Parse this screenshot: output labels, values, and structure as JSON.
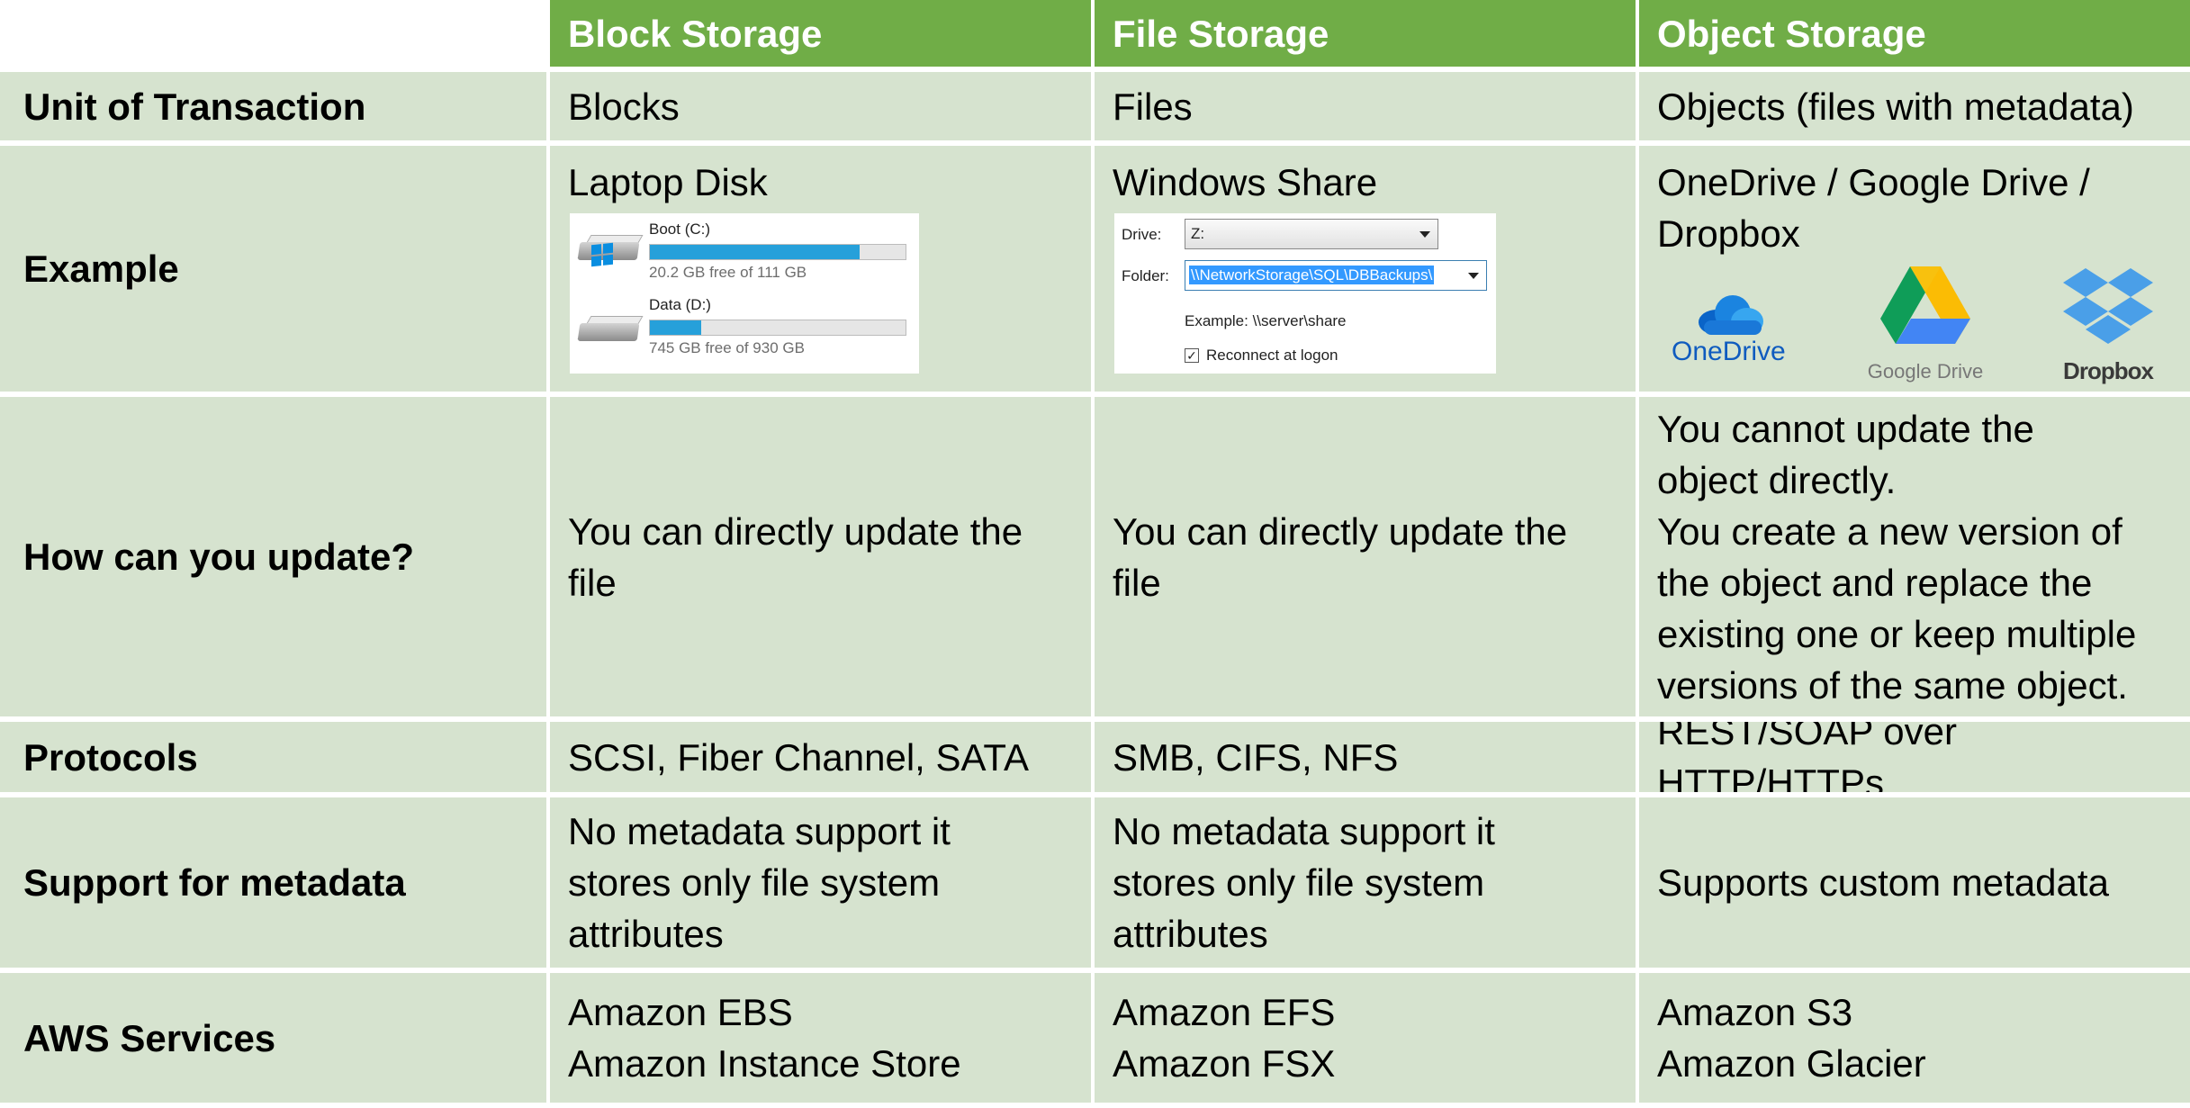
{
  "header": {
    "columns": [
      "Block Storage",
      "File Storage",
      "Object Storage"
    ]
  },
  "rows": {
    "unit": {
      "label": "Unit of Transaction",
      "values": [
        "Blocks",
        "Files",
        "Objects (files with metadata)"
      ]
    },
    "example": {
      "label": "Example",
      "values": [
        "Laptop Disk",
        "Windows Share",
        "OneDrive / Google Drive /\nDropbox"
      ]
    },
    "update": {
      "label": "How can you update?",
      "values": [
        "You can directly update the\nfile",
        "You can directly update the\nfile",
        "You cannot update the\nobject directly.\nYou create a new version of\nthe object and replace the\nexisting one or keep multiple\nversions of the same object."
      ]
    },
    "protocols": {
      "label": "Protocols",
      "values": [
        "SCSI, Fiber Channel, SATA",
        "SMB, CIFS, NFS",
        "REST/SOAP over HTTP/HTTPs"
      ]
    },
    "metadata": {
      "label": "Support for metadata",
      "values": [
        "No metadata support it\nstores only file system\nattributes",
        "No metadata support it\nstores only file system\nattributes",
        "Supports custom metadata"
      ]
    },
    "aws": {
      "label": "AWS Services",
      "values": [
        "Amazon EBS\nAmazon Instance Store",
        "Amazon EFS\nAmazon FSX",
        "Amazon S3\nAmazon Glacier"
      ]
    }
  },
  "laptop_disk": {
    "drives": [
      {
        "name": "Boot (C:)",
        "free": "20.2 GB free of 111 GB",
        "used_fraction": 0.82
      },
      {
        "name": "Data (D:)",
        "free": "745 GB free of 930 GB",
        "used_fraction": 0.2
      }
    ]
  },
  "windows_share": {
    "drive_label": "Drive:",
    "drive_value": "Z:",
    "folder_label": "Folder:",
    "folder_value": "\\\\NetworkStorage\\SQL\\DBBackups\\",
    "example_text": "Example: \\\\server\\share",
    "reconnect_label": "Reconnect at logon",
    "reconnect_checked": true
  },
  "logos": {
    "onedrive": "OneDrive",
    "googledrive": "Google Drive",
    "dropbox": "Dropbox"
  },
  "colors": {
    "header_bg": "#70ad47",
    "cell_bg": "#d6e3cf",
    "onedrive_blue": "#0f5bbf"
  }
}
